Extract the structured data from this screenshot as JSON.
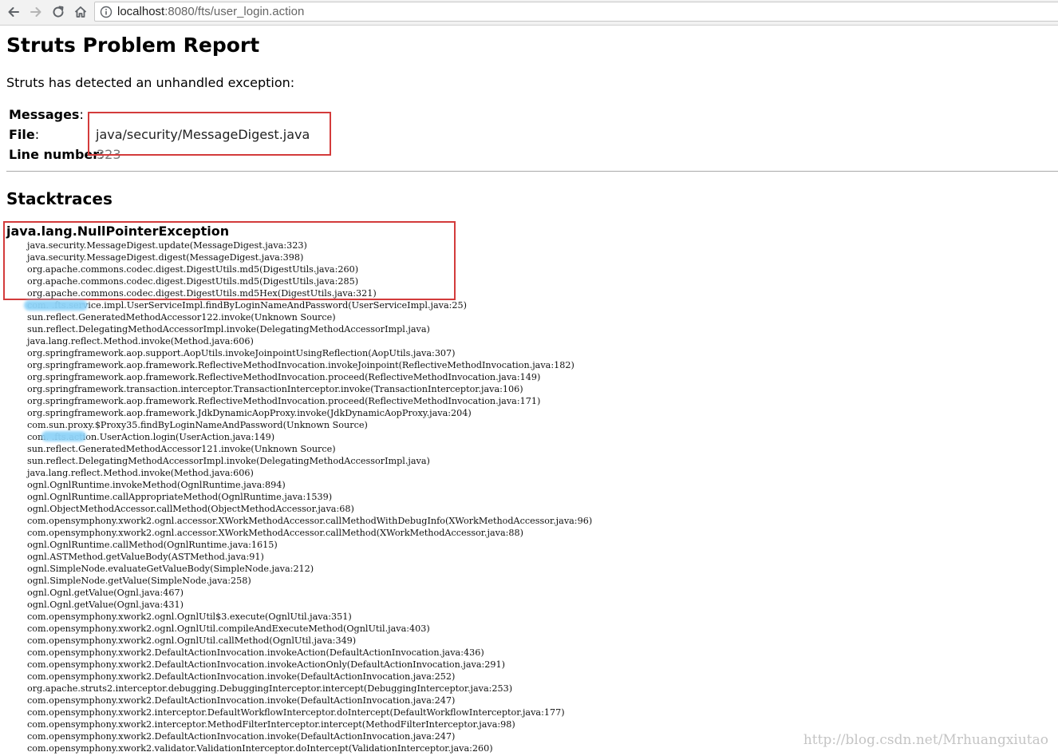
{
  "browser": {
    "url_host": "localhost",
    "url_path": ":8080/fts/user_login.action",
    "icons": [
      "back-arrow-icon",
      "forward-arrow-icon",
      "reload-icon",
      "home-icon",
      "info-circle-icon"
    ]
  },
  "page": {
    "title": "Struts Problem Report",
    "intro": "Struts has detected an unhandled exception:",
    "fields": {
      "messages_label": "Messages",
      "messages_colon": ":",
      "file_label": "File",
      "file_colon": ":",
      "file_value": "java/security/MessageDigest.java",
      "line_label": "Line number",
      "line_colon": ":",
      "line_value": "323"
    },
    "stacktraces_title": "Stacktraces",
    "exception": "java.lang.NullPointerException",
    "trace": [
      "java.security.MessageDigest.update(MessageDigest.java:323)",
      "java.security.MessageDigest.digest(MessageDigest.java:398)",
      "org.apache.commons.codec.digest.DigestUtils.md5(DigestUtils.java:260)",
      "org.apache.commons.codec.digest.DigestUtils.md5(DigestUtils.java:285)",
      "org.apache.commons.codec.digest.DigestUtils.md5Hex(DigestUtils.java:321)",
      "com.          .fts.service.impl.UserServiceImpl.findByLoginNameAndPassword(UserServiceImpl.java:25)",
      "sun.reflect.GeneratedMethodAccessor122.invoke(Unknown Source)",
      "sun.reflect.DelegatingMethodAccessorImpl.invoke(DelegatingMethodAccessorImpl.java)",
      "java.lang.reflect.Method.invoke(Method.java:606)",
      "org.springframework.aop.support.AopUtils.invokeJoinpointUsingReflection(AopUtils.java:307)",
      "org.springframework.aop.framework.ReflectiveMethodInvocation.invokeJoinpoint(ReflectiveMethodInvocation.java:182)",
      "org.springframework.aop.framework.ReflectiveMethodInvocation.proceed(ReflectiveMethodInvocation.java:149)",
      "org.springframework.transaction.interceptor.TransactionInterceptor.invoke(TransactionInterceptor.java:106)",
      "org.springframework.aop.framework.ReflectiveMethodInvocation.proceed(ReflectiveMethodInvocation.java:171)",
      "org.springframework.aop.framework.JdkDynamicAopProxy.invoke(JdkDynamicAopProxy.java:204)",
      "com.sun.proxy.$Proxy35.findByLoginNameAndPassword(Unknown Source)",
      "com.        .fts.action.UserAction.login(UserAction.java:149)",
      "sun.reflect.GeneratedMethodAccessor121.invoke(Unknown Source)",
      "sun.reflect.DelegatingMethodAccessorImpl.invoke(DelegatingMethodAccessorImpl.java)",
      "java.lang.reflect.Method.invoke(Method.java:606)",
      "ognl.OgnlRuntime.invokeMethod(OgnlRuntime.java:894)",
      "ognl.OgnlRuntime.callAppropriateMethod(OgnlRuntime.java:1539)",
      "ognl.ObjectMethodAccessor.callMethod(ObjectMethodAccessor.java:68)",
      "com.opensymphony.xwork2.ognl.accessor.XWorkMethodAccessor.callMethodWithDebugInfo(XWorkMethodAccessor.java:96)",
      "com.opensymphony.xwork2.ognl.accessor.XWorkMethodAccessor.callMethod(XWorkMethodAccessor.java:88)",
      "ognl.OgnlRuntime.callMethod(OgnlRuntime.java:1615)",
      "ognl.ASTMethod.getValueBody(ASTMethod.java:91)",
      "ognl.SimpleNode.evaluateGetValueBody(SimpleNode.java:212)",
      "ognl.SimpleNode.getValue(SimpleNode.java:258)",
      "ognl.Ognl.getValue(Ognl.java:467)",
      "ognl.Ognl.getValue(Ognl.java:431)",
      "com.opensymphony.xwork2.ognl.OgnlUtil$3.execute(OgnlUtil.java:351)",
      "com.opensymphony.xwork2.ognl.OgnlUtil.compileAndExecuteMethod(OgnlUtil.java:403)",
      "com.opensymphony.xwork2.ognl.OgnlUtil.callMethod(OgnlUtil.java:349)",
      "com.opensymphony.xwork2.DefaultActionInvocation.invokeAction(DefaultActionInvocation.java:436)",
      "com.opensymphony.xwork2.DefaultActionInvocation.invokeActionOnly(DefaultActionInvocation.java:291)",
      "com.opensymphony.xwork2.DefaultActionInvocation.invoke(DefaultActionInvocation.java:252)",
      "org.apache.struts2.interceptor.debugging.DebuggingInterceptor.intercept(DebuggingInterceptor.java:253)",
      "com.opensymphony.xwork2.DefaultActionInvocation.invoke(DefaultActionInvocation.java:247)",
      "com.opensymphony.xwork2.interceptor.DefaultWorkflowInterceptor.doIntercept(DefaultWorkflowInterceptor.java:177)",
      "com.opensymphony.xwork2.interceptor.MethodFilterInterceptor.intercept(MethodFilterInterceptor.java:98)",
      "com.opensymphony.xwork2.DefaultActionInvocation.invoke(DefaultActionInvocation.java:247)",
      "com.opensymphony.xwork2.validator.ValidationInterceptor.doIntercept(ValidationInterceptor.java:260)"
    ],
    "watermark": "http://blog.csdn.net/Mrhuangxiutao",
    "colors": {
      "annotation_red": "#d33b3b",
      "redaction_blue": "#8fd3f8"
    }
  }
}
